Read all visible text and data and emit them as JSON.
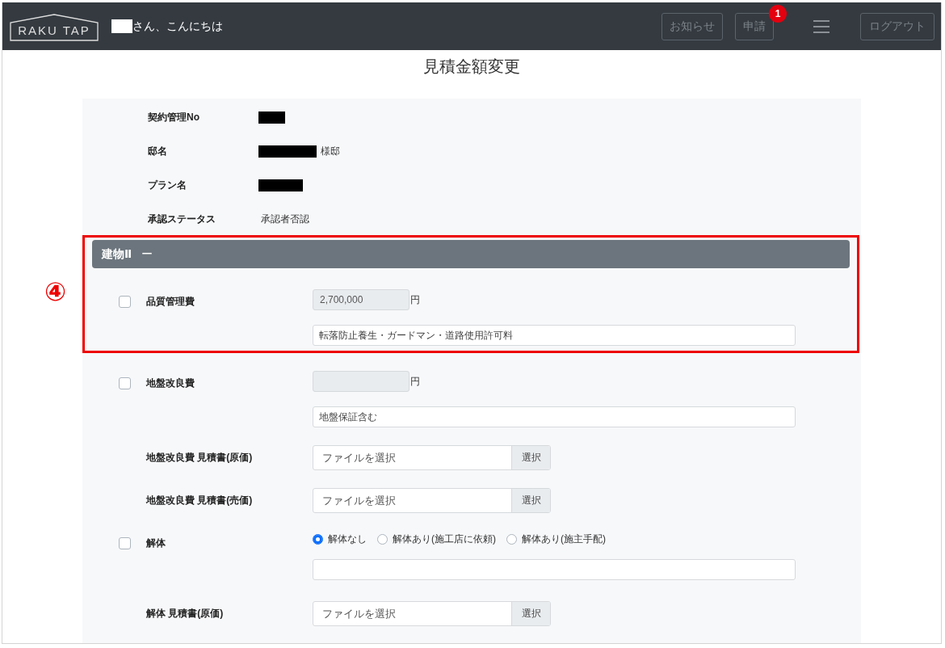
{
  "header": {
    "logo": "RAKU TAP",
    "greeting": {
      "redacted": true,
      "text": "さん、こんにちは"
    },
    "buttons": [
      {
        "label": "お知らせ"
      },
      {
        "label": "申請",
        "badge": "1"
      }
    ],
    "logout": "ログアウト"
  },
  "page_title": "見積金額変更",
  "info": [
    {
      "label": "契約管理No",
      "redacted": true
    },
    {
      "label": "邸名",
      "redacted": true,
      "suffix": "様邸"
    },
    {
      "label": "プラン名",
      "redacted": true
    },
    {
      "label": "承認ステータス",
      "value": "承認者否認"
    }
  ],
  "section": {
    "title": "建物Ⅱ",
    "toggle": "ー",
    "annotation": {
      "marker": "④"
    }
  },
  "items": [
    {
      "kind": "amount",
      "label": "品質管理費",
      "checked": false,
      "annotated": true,
      "amount": "2,700,000",
      "unit": "円",
      "note": "転落防止養生・ガードマン・道路使用許可料"
    },
    {
      "kind": "amount",
      "label": "地盤改良費",
      "checked": false,
      "unit": "円",
      "note": "地盤保証含む"
    },
    {
      "kind": "file",
      "label": "地盤改良費 見積書(原価)",
      "placeholder": "ファイルを選択",
      "button": "選択"
    },
    {
      "kind": "file",
      "label": "地盤改良費 見積書(売価)",
      "placeholder": "ファイルを選択",
      "button": "選択"
    },
    {
      "kind": "radio",
      "label": "解体",
      "checked": false,
      "options": [
        {
          "label": "解体なし",
          "selected": true
        },
        {
          "label": "解体あり(施工店に依頼)",
          "selected": false
        },
        {
          "label": "解体あり(施主手配)",
          "selected": false
        }
      ]
    },
    {
      "kind": "file",
      "label": "解体 見積書(原価)",
      "placeholder": "ファイルを選択",
      "button": "選択"
    }
  ]
}
